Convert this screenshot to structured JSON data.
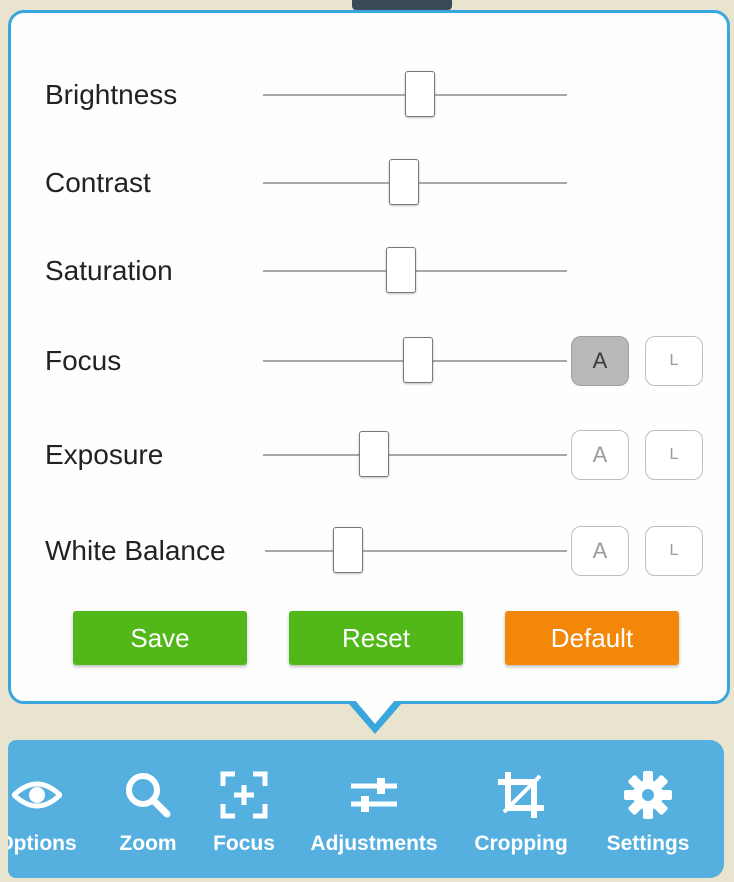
{
  "sliders": [
    {
      "label": "Brightness",
      "value_fraction": 0.52,
      "modes": []
    },
    {
      "label": "Contrast",
      "value_fraction": 0.46,
      "modes": []
    },
    {
      "label": "Saturation",
      "value_fraction": 0.45,
      "modes": []
    },
    {
      "label": "Focus",
      "value_fraction": 0.51,
      "modes": [
        {
          "label": "A",
          "active": true
        },
        {
          "label": "L",
          "active": false
        }
      ]
    },
    {
      "label": "Exposure",
      "value_fraction": 0.35,
      "modes": [
        {
          "label": "A",
          "active": false
        },
        {
          "label": "L",
          "active": false
        }
      ]
    },
    {
      "label": "White Balance",
      "value_fraction": 0.25,
      "modes": [
        {
          "label": "A",
          "active": false
        },
        {
          "label": "L",
          "active": false
        }
      ]
    }
  ],
  "actions": {
    "save_label": "Save",
    "reset_label": "Reset",
    "default_label": "Default"
  },
  "toolbar": {
    "items": [
      {
        "label": "Options",
        "icon": "eye-icon"
      },
      {
        "label": "Zoom",
        "icon": "magnifier-icon"
      },
      {
        "label": "Focus",
        "icon": "focus-frame-icon"
      },
      {
        "label": "Adjustments",
        "icon": "sliders-icon"
      },
      {
        "label": "Cropping",
        "icon": "crop-icon"
      },
      {
        "label": "Settings",
        "icon": "gear-icon"
      }
    ]
  },
  "colors": {
    "accent_blue": "#3aa6de",
    "toolbar_blue": "#55b0e0",
    "button_green": "#52b81a",
    "button_orange": "#f2870a"
  }
}
